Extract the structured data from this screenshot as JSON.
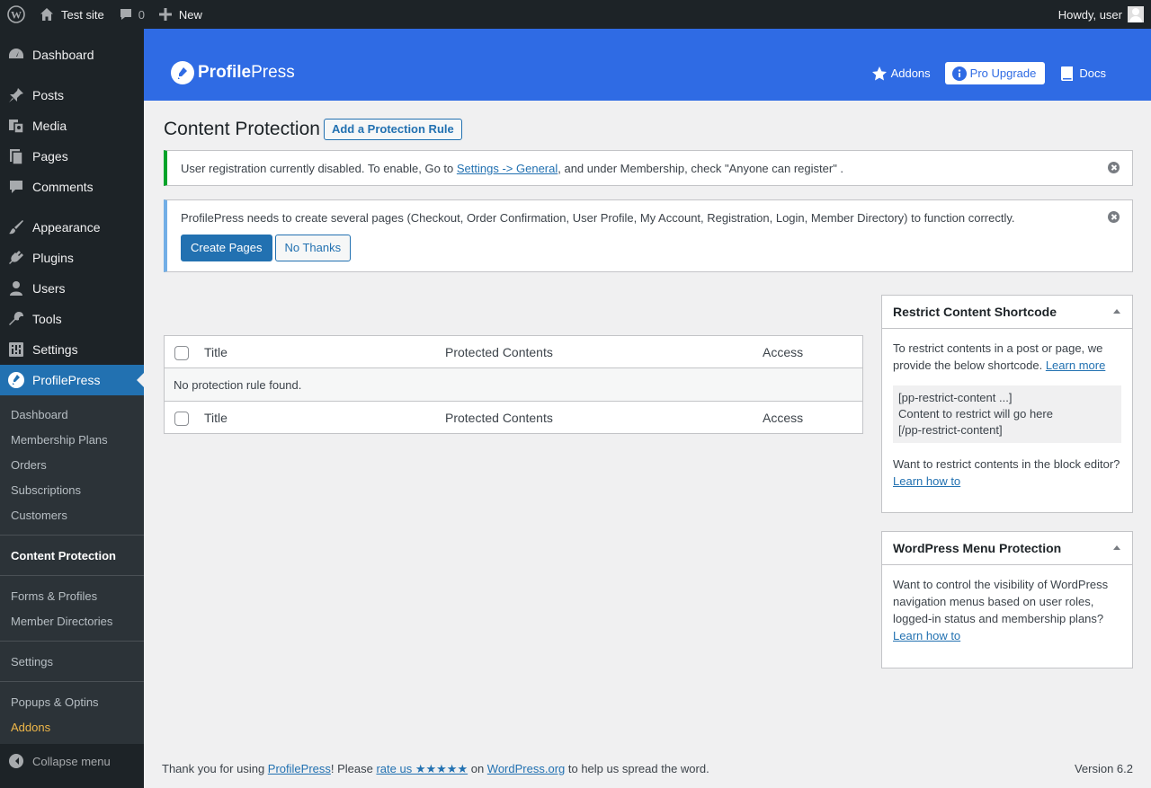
{
  "adminbar": {
    "site_name": "Test site",
    "comments_count": "0",
    "new_label": "New",
    "howdy": "Howdy, user"
  },
  "menu": {
    "items": [
      {
        "label": "Dashboard",
        "icon": "dashboard-icon"
      },
      {
        "label": "Posts",
        "icon": "pin-icon"
      },
      {
        "label": "Media",
        "icon": "media-icon"
      },
      {
        "label": "Pages",
        "icon": "pages-icon"
      },
      {
        "label": "Comments",
        "icon": "comment-icon"
      },
      {
        "label": "Appearance",
        "icon": "brush-icon"
      },
      {
        "label": "Plugins",
        "icon": "plug-icon"
      },
      {
        "label": "Users",
        "icon": "user-icon"
      },
      {
        "label": "Tools",
        "icon": "wrench-icon"
      },
      {
        "label": "Settings",
        "icon": "sliders-icon"
      },
      {
        "label": "ProfilePress",
        "icon": "profilepress-icon"
      }
    ],
    "submenu": {
      "group1": [
        "Dashboard",
        "Membership Plans",
        "Orders",
        "Subscriptions",
        "Customers"
      ],
      "group2": [
        "Content Protection"
      ],
      "group3": [
        "Forms & Profiles",
        "Member Directories"
      ],
      "group4": [
        "Settings"
      ],
      "group5": [
        "Popups & Optins",
        "Addons"
      ]
    },
    "collapse_label": "Collapse menu"
  },
  "header": {
    "logo_bold": "Profile",
    "logo_light": "Press",
    "nav": {
      "addons": "Addons",
      "upgrade": "Pro Upgrade",
      "docs": "Docs"
    }
  },
  "page": {
    "title": "Content Protection",
    "add_button": "Add a Protection Rule"
  },
  "notices": {
    "registration": {
      "before": "User registration currently disabled. To enable, Go to ",
      "link": "Settings -> General",
      "after": ", and under Membership, check \"Anyone can register\" ."
    },
    "pages": {
      "text": "ProfilePress needs to create several pages (Checkout, Order Confirmation, User Profile, My Account, Registration, Login, Member Directory) to function correctly.",
      "create_button": "Create Pages",
      "dismiss_button": "No Thanks"
    }
  },
  "table": {
    "columns": [
      "Title",
      "Protected Contents",
      "Access"
    ],
    "empty_text": "No protection rule found."
  },
  "restrict_box": {
    "title": "Restrict Content Shortcode",
    "intro": "To restrict contents in a post or page, we provide the below shortcode. ",
    "learn_more": "Learn more",
    "code_lines": [
      "[pp-restrict-content ...]",
      "Content to restrict will go here",
      "[/pp-restrict-content]"
    ],
    "block_editor_text": "Want to restrict contents in the block editor? ",
    "block_editor_link": "Learn how to"
  },
  "menu_box": {
    "title": "WordPress Menu Protection",
    "text": "Want to control the visibility of WordPress navigation menus based on user roles, logged-in status and membership plans? ",
    "link": "Learn how to"
  },
  "footer": {
    "before": "Thank you for using ",
    "pp_link": "ProfilePress",
    "mid": "! Please ",
    "rate_link": "rate us ★★★★★",
    "on": " on ",
    "wporg_link": "WordPress.org",
    "after": " to help us spread the word.",
    "version": "Version 6.2"
  },
  "colors": {
    "admin_bar": "#1d2327",
    "header_blue": "#2f6be4",
    "wp_blue": "#2271b1",
    "success": "#00a32a",
    "info": "#72aee6",
    "addons_orange": "#f0b849"
  }
}
